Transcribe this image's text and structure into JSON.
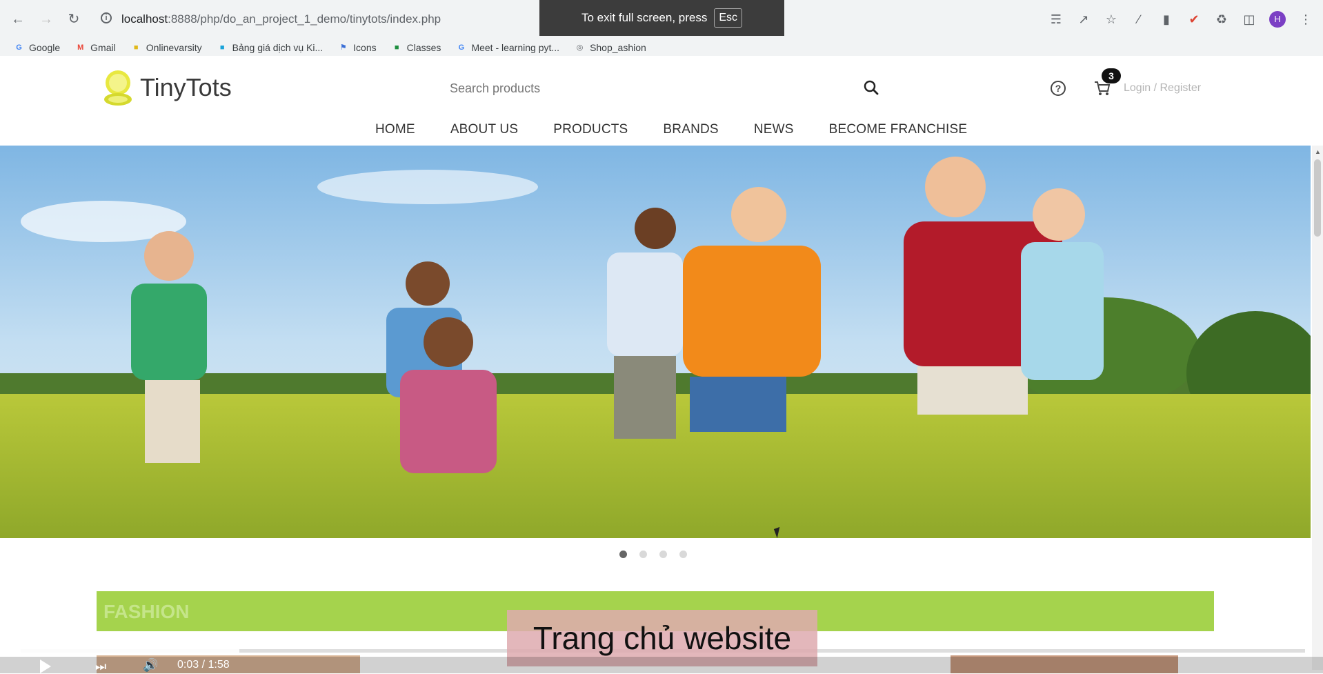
{
  "browser": {
    "url_host": "localhost",
    "url_path": ":8888/php/do_an_project_1_demo/tinytots/index.php",
    "fullscreen_message": "To exit full screen, press",
    "fullscreen_key": "Esc",
    "profile_initial": "H",
    "bookmarks": [
      {
        "label": "Google",
        "icon": "google-icon",
        "color": "#4285f4"
      },
      {
        "label": "Gmail",
        "icon": "gmail-icon",
        "color": "#ea4335"
      },
      {
        "label": "Onlinevarsity",
        "icon": "ov-icon",
        "color": "#e0b81a"
      },
      {
        "label": "Bảng giá dịch vụ Ki...",
        "icon": "ki-icon",
        "color": "#1aa3d9"
      },
      {
        "label": "Icons",
        "icon": "flag-icon",
        "color": "#3b6fd6"
      },
      {
        "label": "Classes",
        "icon": "classroom-icon",
        "color": "#1e8e3e"
      },
      {
        "label": "Meet - learning pyt...",
        "icon": "google-icon",
        "color": "#4285f4"
      },
      {
        "label": "Shop_ashion",
        "icon": "globe-icon",
        "color": "#5f6368"
      }
    ]
  },
  "site": {
    "logo_text": "TinyTots",
    "search_placeholder": "Search products",
    "cart_count": "3",
    "login_text": "Login / Register",
    "nav": [
      "HOME",
      "ABOUT US",
      "PRODUCTS",
      "BRANDS",
      "NEWS",
      "BECOME FRANCHISE"
    ],
    "section_title": "FASHION",
    "slider_count": 4,
    "slider_active": 1
  },
  "video": {
    "subtitle": "Trang chủ website",
    "time": "0:03 / 1:58",
    "progress": 0.17
  },
  "colors": {
    "accent_green": "#a5d34d",
    "logo_yellow": "#e8e840"
  }
}
